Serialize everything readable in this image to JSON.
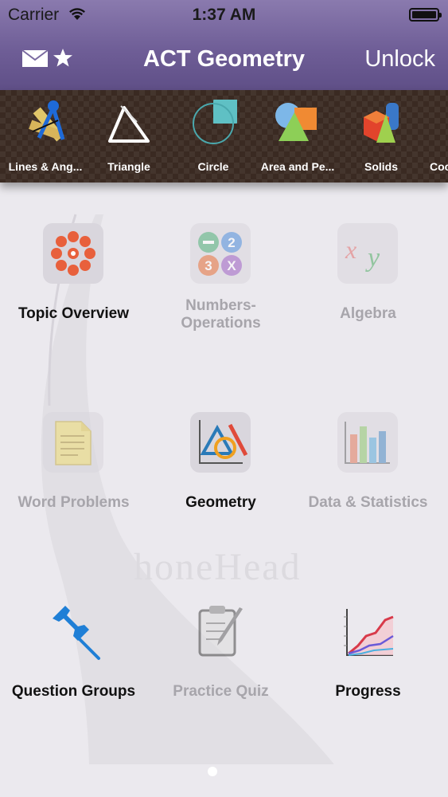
{
  "status": {
    "carrier": "Carrier",
    "time": "1:37 AM"
  },
  "nav": {
    "title": "ACT Geometry",
    "unlock_label": "Unlock"
  },
  "topics": [
    {
      "label": "Lines & Ang...",
      "icon": "lines-angles-icon"
    },
    {
      "label": "Triangle",
      "icon": "triangle-icon"
    },
    {
      "label": "Circle",
      "icon": "circle-icon"
    },
    {
      "label": "Area and Pe...",
      "icon": "area-perimeter-icon"
    },
    {
      "label": "Solids",
      "icon": "solids-icon"
    },
    {
      "label": "Coo",
      "icon": "coordinate-icon"
    }
  ],
  "menu": [
    {
      "label": "Topic Overview",
      "icon": "flower-icon",
      "enabled": true
    },
    {
      "label": "Numbers-\nOperations",
      "icon": "numbers-icon",
      "enabled": false
    },
    {
      "label": "Algebra",
      "icon": "xy-icon",
      "enabled": false
    },
    {
      "label": "Word Problems",
      "icon": "document-icon",
      "enabled": false
    },
    {
      "label": "Geometry",
      "icon": "geometry-icon",
      "enabled": true
    },
    {
      "label": "Data & Statistics",
      "icon": "bar-chart-icon",
      "enabled": false
    },
    {
      "label": "Question Groups",
      "icon": "pushpin-icon",
      "enabled": true
    },
    {
      "label": "Practice Quiz",
      "icon": "clipboard-pencil-icon",
      "enabled": false
    },
    {
      "label": "Progress",
      "icon": "line-chart-icon",
      "enabled": true
    }
  ],
  "watermark": "honeHead",
  "colors": {
    "nav": "#6f5e97",
    "active_text": "#111111",
    "disabled_text": "#a7a5ab"
  }
}
